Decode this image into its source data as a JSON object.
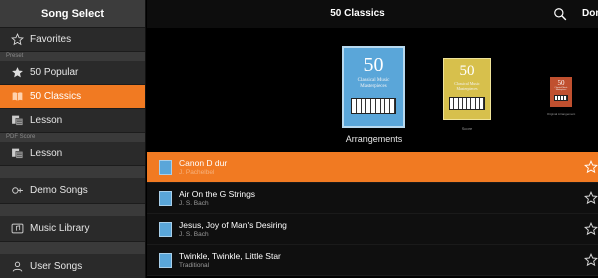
{
  "sidebar": {
    "header": "Song Select",
    "items": [
      {
        "label": "Favorites",
        "icon": "star-outline-icon"
      },
      {
        "label": "50 Popular",
        "icon": "star-filled-icon"
      },
      {
        "label": "50 Classics",
        "icon": "book-icon",
        "selected": true
      },
      {
        "label": "Lesson",
        "icon": "lesson-icon"
      },
      {
        "label": "Lesson",
        "icon": "lesson-icon"
      },
      {
        "label": "Demo Songs",
        "icon": "demo-songs-icon"
      },
      {
        "label": "Music Library",
        "icon": "music-library-icon"
      },
      {
        "label": "User Songs",
        "icon": "user-icon"
      }
    ],
    "sections": [
      "Preset",
      "PDF Score"
    ]
  },
  "topbar": {
    "title": "50 Classics",
    "done_label": "Done"
  },
  "covers": [
    {
      "number": "50",
      "subtitle": "Classical Music Masterpieces",
      "label": "Arrangements"
    },
    {
      "number": "50",
      "subtitle": "Classical Music Masterpieces",
      "label": "Score"
    },
    {
      "number": "50",
      "subtitle": "Classical Music Masterpieces",
      "label": "Original Arrangement"
    }
  ],
  "songs": [
    {
      "title": "Canon D dur",
      "composer": "J. Pachelbel",
      "selected": true
    },
    {
      "title": "Air On the G Strings",
      "composer": "J. S. Bach"
    },
    {
      "title": "Jesus, Joy of Man's Desiring",
      "composer": "J. S. Bach"
    },
    {
      "title": "Twinkle, Twinkle, Little Star",
      "composer": "Traditional"
    }
  ],
  "colors": {
    "accent": "#f17a22",
    "cover_blue": "#5aa6d9",
    "cover_gold": "#d7c04c",
    "cover_red": "#c0502f"
  }
}
